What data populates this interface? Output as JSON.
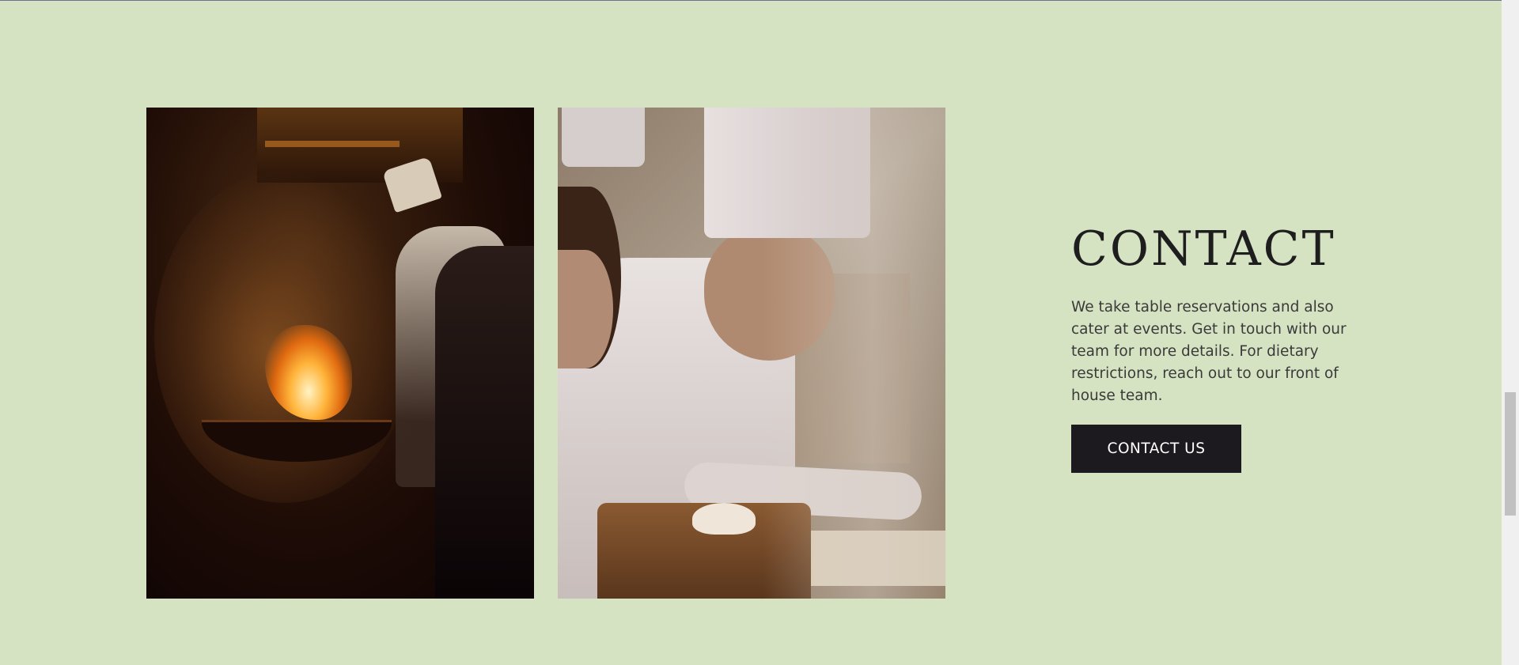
{
  "contact": {
    "title": "CONTACT",
    "description": "We take table reservations and also cater at events. Get in touch with our team for more details. For dietary restrictions, reach out to our front of house team.",
    "button_label": "CONTACT US"
  },
  "colors": {
    "background": "#d6e3c2",
    "button_bg": "#1c1a1f",
    "button_text": "#ffffff",
    "heading": "#1e1e1e",
    "body_text": "#3a3a3a"
  },
  "images": [
    {
      "name": "chef-wok-photo"
    },
    {
      "name": "dumpling-chefs-photo"
    }
  ],
  "scrollbar": {
    "visible": true
  }
}
